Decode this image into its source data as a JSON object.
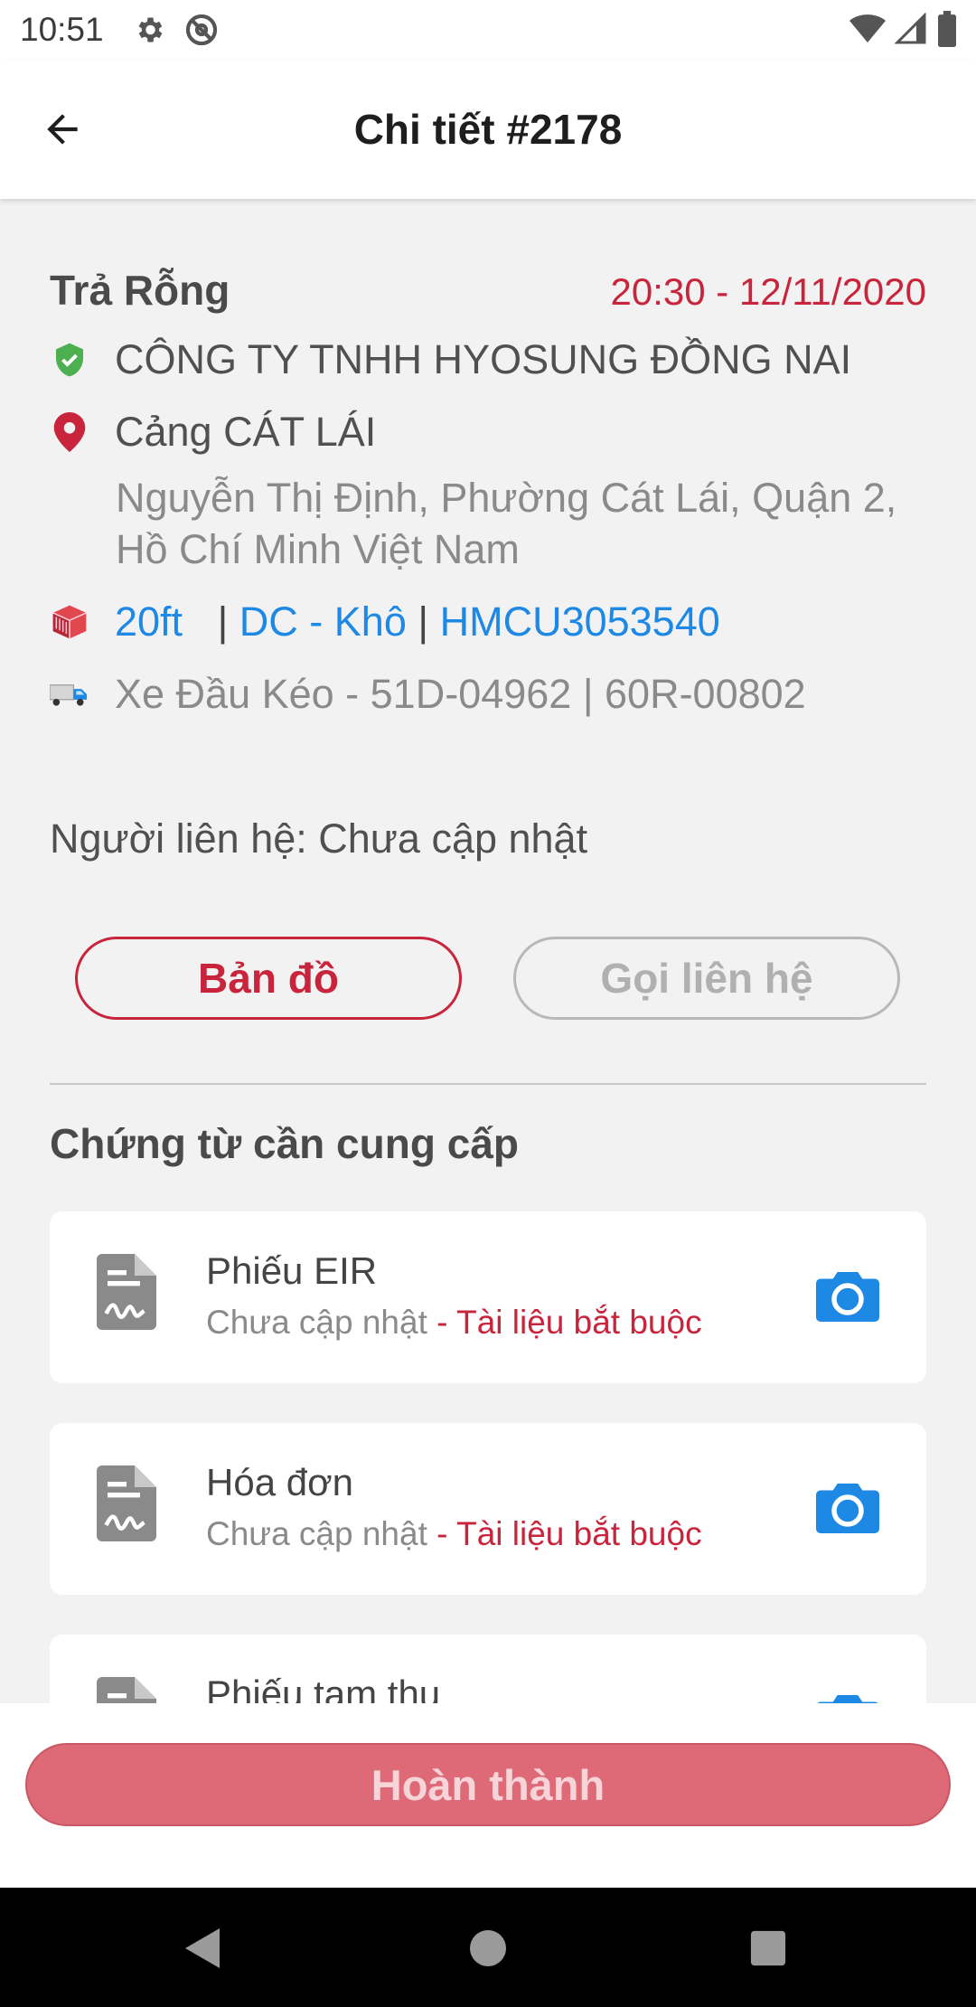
{
  "status_bar": {
    "time": "10:51",
    "left_icons": [
      "gear-icon",
      "at-sign-icon"
    ],
    "right_icons": [
      "wifi-icon",
      "cellular-signal-icon",
      "battery-icon"
    ]
  },
  "app_bar": {
    "title": "Chi tiết #2178",
    "back_icon": "arrow-left-icon"
  },
  "trip": {
    "type": "Trả Rỗng",
    "datetime": "20:30 - 12/11/2020",
    "company": "CÔNG TY TNHH HYOSUNG ĐỒNG NAI",
    "location_name": "Cảng CÁT LÁI",
    "location_address": "Nguyễn Thị Định, Phường Cát Lái, Quận 2, Hồ Chí Minh Việt Nam",
    "container_size": "20ft",
    "separator": "|",
    "container_type": "DC - Khô",
    "container_number": "HMCU3053540",
    "vehicle_text": "Xe Đầu Kéo  - 51D-04962 | 60R-00802"
  },
  "contact": {
    "text": "Người liên hệ: Chưa cập nhật"
  },
  "actions": {
    "map_label": "Bản đồ",
    "call_label": "Gọi liên hệ"
  },
  "documents": {
    "section_title": "Chứng từ cần cung cấp",
    "items": [
      {
        "name": "Phiếu EIR",
        "status": "Chưa cập nhật",
        "required": " - Tài liệu bắt buộc"
      },
      {
        "name": "Hóa đơn",
        "status": "Chưa cập nhật",
        "required": " - Tài liệu bắt buộc"
      },
      {
        "name": "Phiếu tạm thu",
        "status": "",
        "required": ""
      }
    ]
  },
  "footer": {
    "done_label": "Hoàn thành"
  },
  "colors": {
    "accent_red": "#c8243c",
    "link_blue": "#1e88e5",
    "done_button": "#de6a78",
    "verified_green": "#4caf50"
  }
}
